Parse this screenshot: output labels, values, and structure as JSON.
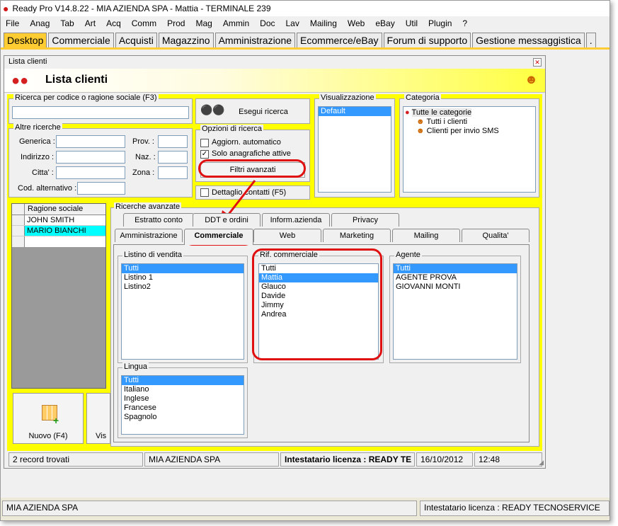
{
  "app": {
    "title": "Ready Pro V14.8.22 - MIA AZIENDA SPA - Mattia - TERMINALE 239",
    "menu": [
      "File",
      "Anag",
      "Tab",
      "Art",
      "Acq",
      "Comm",
      "Prod",
      "Mag",
      "Ammin",
      "Doc",
      "Lav",
      "Mailing",
      "Web",
      "eBay",
      "Util",
      "Plugin",
      "?"
    ],
    "tabs": [
      "Desktop",
      "Commerciale",
      "Acquisti",
      "Magazzino",
      "Amministrazione",
      "Ecommerce/eBay",
      "Forum di supporto",
      "Gestione messaggistica",
      "."
    ],
    "active_tab": "Desktop",
    "status_left": "MIA AZIENDA SPA",
    "status_right": "Intestatario licenza : READY TECNOSERVICE"
  },
  "window": {
    "title": "Lista clienti",
    "heading": "Lista clienti",
    "search": {
      "label": "Ricerca per codice o ragione sociale (F3)",
      "value": "",
      "button": "Esegui ricerca"
    },
    "other": {
      "label": "Altre ricerche",
      "generica": "Generica :",
      "indirizzo": "Indirizzo :",
      "citta": "Citta' :",
      "prov": "Prov. :",
      "naz": "Naz. :",
      "zona": "Zona :",
      "cod_alt": "Cod. alternativo :"
    },
    "options": {
      "label": "Opzioni di ricerca",
      "auto": "Aggiorn. automatico",
      "auto_checked": false,
      "attive": "Solo anagrafiche attive",
      "attive_checked": true,
      "filtri": "Filtri avanzati",
      "dettaglio": "Dettaglio contatti (F5)"
    },
    "view": {
      "label": "Visualizzazione",
      "items": [
        "Default"
      ]
    },
    "category": {
      "label": "Categoria",
      "root": "Tutte le categorie",
      "children": [
        "Tutti i clienti",
        "Clienti per invio SMS"
      ]
    },
    "grid": {
      "header": "Ragione sociale",
      "rows": [
        "JOHN SMITH",
        "MARIO BIANCHI"
      ]
    },
    "buttons": {
      "nuovo": "Nuovo (F4)",
      "vis": "Vis"
    },
    "advanced": {
      "label": "Ricerche avanzate",
      "tabs_row1": [
        "Estratto conto",
        "DDT e ordini",
        "Inform.azienda",
        "Privacy"
      ],
      "tabs_row2": [
        "Amministrazione",
        "Commerciale",
        "Web",
        "Marketing",
        "Mailing",
        "Qualita'"
      ],
      "active": "Commerciale",
      "listino": {
        "label": "Listino di vendita",
        "items": [
          "Tutti",
          "Listino 1",
          "Listino2"
        ]
      },
      "rif": {
        "label": "Rif. commerciale",
        "items": [
          "Tutti",
          "Mattia",
          "Glauco",
          "Davide",
          "Jimmy",
          "Andrea"
        ]
      },
      "agente": {
        "label": "Agente",
        "items": [
          "Tutti",
          "AGENTE PROVA",
          "GIOVANNI MONTI"
        ]
      },
      "lingua": {
        "label": "Lingua",
        "items": [
          "Tutti",
          "Italiano",
          "Inglese",
          "Francese",
          "Spagnolo"
        ]
      }
    },
    "status": {
      "records": "2 record trovati",
      "company": "MIA AZIENDA SPA",
      "license": "Intestatario licenza : READY TE",
      "date": "16/10/2012",
      "time": "12:48"
    }
  }
}
